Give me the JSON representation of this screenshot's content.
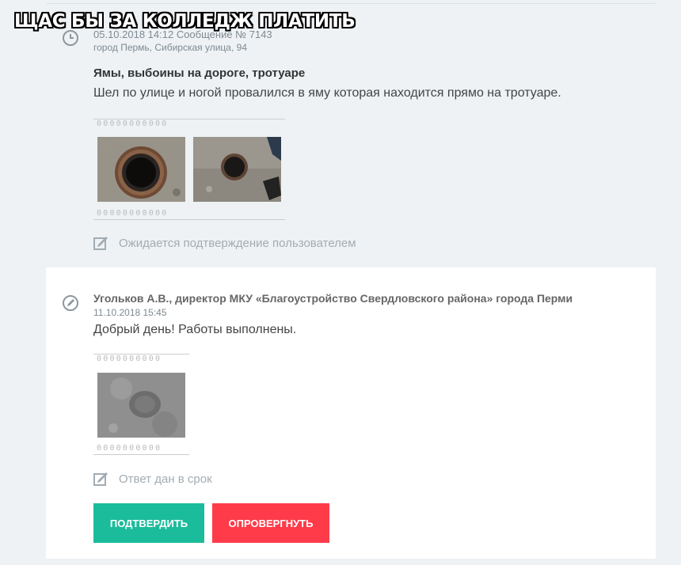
{
  "meme_caption": "ЩАС БЫ ЗА КОЛЛЕДЖ ПЛАТИТЬ",
  "report": {
    "meta_line": "05.10.2018 14:12 Сообщение № 7143",
    "address": "город Пермь, Сибирская улица, 94",
    "title": "Ямы, выбоины на дороге, тротуаре",
    "text": "Шел по улице и ногой провалился в яму которая находится прямо на тротуаре.",
    "film_marks": "00000000000",
    "status": "Ожидается подтверждение пользователем",
    "icons": [
      "clock-icon",
      "edit-status-icon"
    ]
  },
  "reply": {
    "author": "Угольков А.В., директор МКУ «Благоустройство Свердловского района» города Перми",
    "datetime": "11.10.2018 15:45",
    "text": "Добрый день! Работы выполнены.",
    "film_marks": "0000000000",
    "status": "Ответ дан в срок",
    "confirm_label": "ПОДТВЕРДИТЬ",
    "refute_label": "ОПРОВЕРГНУТЬ",
    "icons": [
      "pencil-circle-icon",
      "edit-status-icon"
    ],
    "colors": {
      "confirm": "#1bbc9b",
      "refute": "#ff3b4a",
      "accent": "#16a085"
    }
  }
}
